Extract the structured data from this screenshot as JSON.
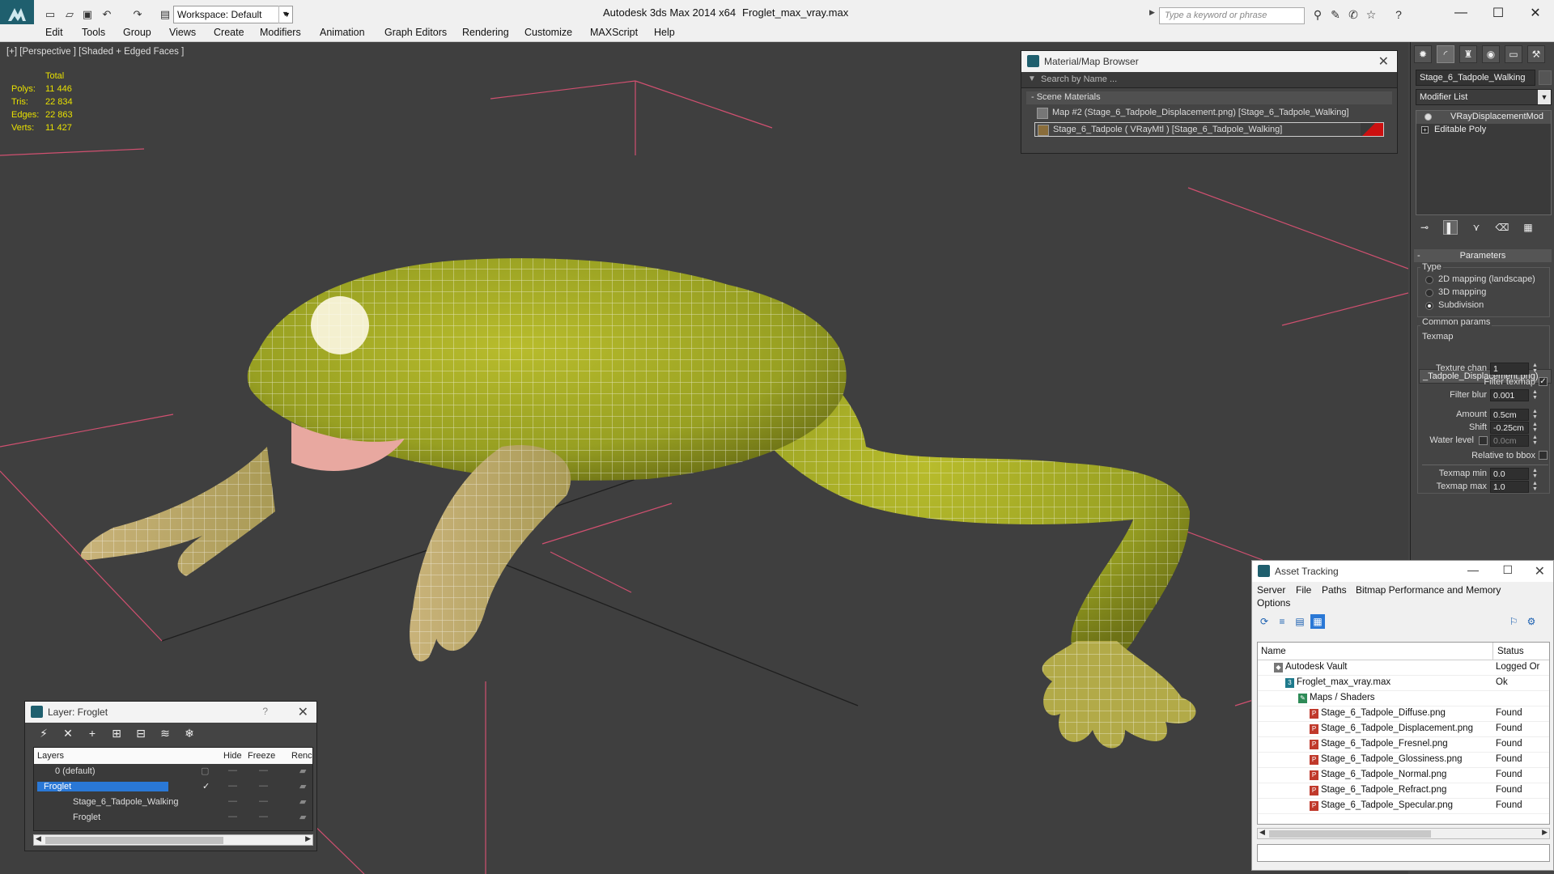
{
  "titlebar": {
    "workspace": "Workspace: Default",
    "app_title": "Autodesk 3ds Max  2014 x64",
    "file_title": "Froglet_max_vray.max",
    "search_placeholder": "Type a keyword or phrase",
    "minimize": "—",
    "maximize": "☐",
    "close": "✕"
  },
  "menu": [
    "Edit",
    "Tools",
    "Group",
    "Views",
    "Create",
    "Modifiers",
    "Animation",
    "Graph Editors",
    "Rendering",
    "Customize",
    "MAXScript",
    "Help"
  ],
  "viewport": {
    "label": "[+] [Perspective ] [Shaded + Edged Faces ]",
    "stats": {
      "header": "Total",
      "rows": [
        {
          "key": "Polys:",
          "value": "11 446"
        },
        {
          "key": "Tris:",
          "value": "22 834"
        },
        {
          "key": "Edges:",
          "value": "22 863"
        },
        {
          "key": "Verts:",
          "value": "11 427"
        }
      ]
    }
  },
  "material_browser": {
    "title": "Material/Map Browser",
    "search": "Search by Name ...",
    "section": "- Scene Materials",
    "items": [
      "Map #2 (Stage_6_Tadpole_Displacement.png) [Stage_6_Tadpole_Walking]",
      "Stage_6_Tadpole  ( VRayMtl )  [Stage_6_Tadpole_Walking]"
    ]
  },
  "command_panel": {
    "object_name": "Stage_6_Tadpole_Walking",
    "modifier_list": "Modifier List",
    "stack": [
      "VRayDisplacementMod",
      "Editable Poly"
    ],
    "rollout": "Parameters",
    "type_label": "Type",
    "radios": [
      "2D mapping (landscape)",
      "3D mapping",
      "Subdivision"
    ],
    "common_label": "Common params",
    "texmap_label": "Texmap",
    "texmap_value": "_Tadpole_Displacement.png)",
    "params": {
      "texture_chan": {
        "label": "Texture chan",
        "value": "1"
      },
      "filter_texmap": {
        "label": "Filter texmap"
      },
      "filter_blur": {
        "label": "Filter blur",
        "value": "0.001"
      },
      "amount": {
        "label": "Amount",
        "value": "0.5cm"
      },
      "shift": {
        "label": "Shift",
        "value": "-0.25cm"
      },
      "water_level": {
        "label": "Water level",
        "value": "0.0cm"
      },
      "relative_bbox": {
        "label": "Relative to bbox"
      },
      "texmap_min": {
        "label": "Texmap min",
        "value": "0.0"
      },
      "texmap_max": {
        "label": "Texmap max",
        "value": "1.0"
      }
    }
  },
  "layer_panel": {
    "title": "Layer: Froglet",
    "help": "?",
    "columns": [
      "Layers",
      "Hide",
      "Freeze",
      "Renc"
    ],
    "rows": [
      {
        "name": "0 (default)"
      },
      {
        "name": "Froglet"
      },
      {
        "name": "Stage_6_Tadpole_Walking"
      },
      {
        "name": "Froglet"
      }
    ]
  },
  "asset_tracking": {
    "title": "Asset Tracking",
    "menu": [
      "Server",
      "File",
      "Paths",
      "Bitmap Performance and Memory",
      "Options"
    ],
    "columns": [
      "Name",
      "Status"
    ],
    "rows": [
      {
        "name": "Autodesk Vault",
        "status": "Logged Or"
      },
      {
        "name": "Froglet_max_vray.max",
        "status": "Ok"
      },
      {
        "name": "Maps / Shaders",
        "status": ""
      },
      {
        "name": "Stage_6_Tadpole_Diffuse.png",
        "status": "Found"
      },
      {
        "name": "Stage_6_Tadpole_Displacement.png",
        "status": "Found"
      },
      {
        "name": "Stage_6_Tadpole_Fresnel.png",
        "status": "Found"
      },
      {
        "name": "Stage_6_Tadpole_Glossiness.png",
        "status": "Found"
      },
      {
        "name": "Stage_6_Tadpole_Normal.png",
        "status": "Found"
      },
      {
        "name": "Stage_6_Tadpole_Refract.png",
        "status": "Found"
      },
      {
        "name": "Stage_6_Tadpole_Specular.png",
        "status": "Found"
      }
    ]
  },
  "colors": {
    "stats_yellow": "#e8e000",
    "selection_blue": "#2a78d6",
    "frog_green": "#a8b02a",
    "grid_pink": "#d05070"
  }
}
